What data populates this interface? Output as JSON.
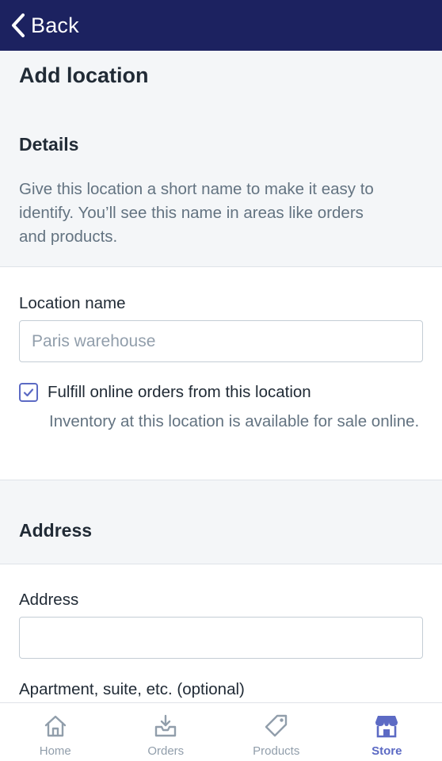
{
  "header": {
    "back_label": "Back"
  },
  "page": {
    "title": "Add location"
  },
  "details": {
    "title": "Details",
    "description": "Give this location a short name to make it easy to identify. You’ll see this name in areas like orders and products."
  },
  "location": {
    "name_label": "Location name",
    "name_placeholder": "Paris warehouse",
    "name_value": "",
    "fulfill_checked": true,
    "fulfill_label": "Fulfill online orders from this location",
    "fulfill_help": "Inventory at this location is available for sale online."
  },
  "address": {
    "title": "Address",
    "address_label": "Address",
    "address_value": "",
    "apartment_label": "Apartment, suite, etc. (optional)"
  },
  "tabs": [
    {
      "label": "Home",
      "icon": "home-icon",
      "active": false
    },
    {
      "label": "Orders",
      "icon": "orders-icon",
      "active": false
    },
    {
      "label": "Products",
      "icon": "tag-icon",
      "active": false
    },
    {
      "label": "Store",
      "icon": "store-icon",
      "active": true
    }
  ],
  "colors": {
    "topbar": "#1c2260",
    "accent": "#5c6ac4",
    "muted_text": "#637381",
    "tab_inactive": "#919eab"
  }
}
